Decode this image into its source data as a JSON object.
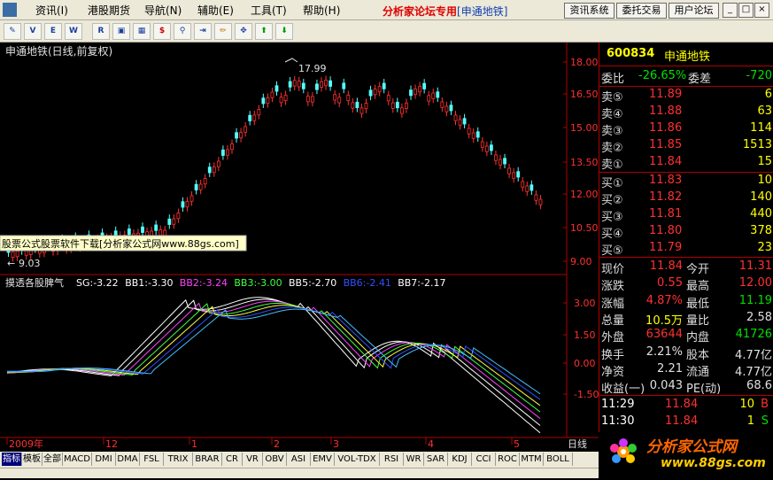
{
  "menubar": {
    "items": [
      "资讯(I)",
      "港股期货",
      "导航(N)",
      "辅助(E)",
      "工具(T)",
      "帮助(H)"
    ],
    "brand": "分析家论坛专用",
    "brand_stock": "[申通地铁]",
    "buttons": [
      "资讯系统",
      "委托交易",
      "用户论坛"
    ]
  },
  "toolbar": {
    "icons": [
      "pencil-icon",
      "vol-icon",
      "etf-icon",
      "win-icon",
      "rsi-icon",
      "window-icon",
      "calc-icon",
      "dollar-icon",
      "link-icon",
      "export-icon",
      "draw-icon",
      "move-icon",
      "arrow-up-icon",
      "arrow-down-icon"
    ]
  },
  "chart": {
    "title": "申通地铁(日线,前复权)",
    "price_labels": [
      "18.00",
      "16.50",
      "15.00",
      "13.50",
      "12.00",
      "10.50",
      "9.00"
    ],
    "high_label": "17.99",
    "low_label": "9.03",
    "watermark": "股票公式股票软件下载[分析家公式网www.88gs.com]",
    "indicator_title": "摸透各股脾气",
    "indicator_values": [
      {
        "text": "SG:-3.22",
        "color": "#ffffff"
      },
      {
        "text": "BB1:-3.30",
        "color": "#ffffff"
      },
      {
        "text": "BB2:-3.24",
        "color": "#ff40ff"
      },
      {
        "text": "BB3:-3.00",
        "color": "#40ff40"
      },
      {
        "text": "BB5:-2.70",
        "color": "#ffffff"
      },
      {
        "text": "BB6:-2.41",
        "color": "#3050ff"
      },
      {
        "text": "BB7:-2.17",
        "color": "#ffffff"
      }
    ],
    "indicator_labels": [
      "3.00",
      "1.50",
      "0.00",
      "-1.50"
    ],
    "x_labels": [
      "2009年",
      "12",
      "1",
      "2",
      "3",
      "4",
      "5"
    ],
    "period": "日线"
  },
  "tabs": [
    "指标",
    "模板",
    "全部",
    "MACD",
    "DMI",
    "DMA",
    "FSL",
    "TRIX",
    "BRAR",
    "CR",
    "VR",
    "OBV",
    "ASI",
    "EMV",
    "VOL-TDX",
    "RSI",
    "WR",
    "SAR",
    "KDJ",
    "CCI",
    "ROC",
    "MTM",
    "BOLL"
  ],
  "quote": {
    "code": "600834",
    "name": "申通地铁",
    "weibi_label": "委比",
    "weibi": "-26.65%",
    "weicha_label": "委差",
    "weicha": "-720",
    "sells": [
      {
        "label": "卖⑤",
        "price": "11.89",
        "vol": "6"
      },
      {
        "label": "卖④",
        "price": "11.88",
        "vol": "63"
      },
      {
        "label": "卖③",
        "price": "11.86",
        "vol": "114"
      },
      {
        "label": "卖②",
        "price": "11.85",
        "vol": "1513"
      },
      {
        "label": "卖①",
        "price": "11.84",
        "vol": "15"
      }
    ],
    "buys": [
      {
        "label": "买①",
        "price": "11.83",
        "vol": "10"
      },
      {
        "label": "买②",
        "price": "11.82",
        "vol": "140"
      },
      {
        "label": "买③",
        "price": "11.81",
        "vol": "440"
      },
      {
        "label": "买④",
        "price": "11.80",
        "vol": "378"
      },
      {
        "label": "买⑤",
        "price": "11.79",
        "vol": "23"
      }
    ],
    "stats": [
      {
        "l1": "现价",
        "v1": "11.84",
        "c1": "red",
        "l2": "今开",
        "v2": "11.31",
        "c2": "red"
      },
      {
        "l1": "涨跌",
        "v1": "0.55",
        "c1": "red",
        "l2": "最高",
        "v2": "12.00",
        "c2": "red"
      },
      {
        "l1": "涨幅",
        "v1": "4.87%",
        "c1": "red",
        "l2": "最低",
        "v2": "11.19",
        "c2": "green"
      },
      {
        "l1": "总量",
        "v1": "10.5万",
        "c1": "yellow",
        "l2": "量比",
        "v2": "2.58",
        "c2": "white"
      },
      {
        "l1": "外盘",
        "v1": "63644",
        "c1": "red",
        "l2": "内盘",
        "v2": "41726",
        "c2": "green"
      },
      {
        "l1": "换手",
        "v1": "2.21%",
        "c1": "white",
        "l2": "股本",
        "v2": "4.77亿",
        "c2": "white"
      },
      {
        "l1": "净资",
        "v1": "2.21",
        "c1": "white",
        "l2": "流通",
        "v2": "4.77亿",
        "c2": "white"
      },
      {
        "l1": "收益(一)",
        "v1": "0.043",
        "c1": "white",
        "l2": "PE(动)",
        "v2": "68.6",
        "c2": "white"
      }
    ],
    "ticks": [
      {
        "time": "11:29",
        "price": "11.84",
        "vol": "10",
        "side": "B"
      },
      {
        "time": "11:30",
        "price": "11.84",
        "vol": "1",
        "side": "S"
      }
    ]
  },
  "logo": {
    "text": "分析家公式网",
    "url": "www.88gs.com"
  }
}
